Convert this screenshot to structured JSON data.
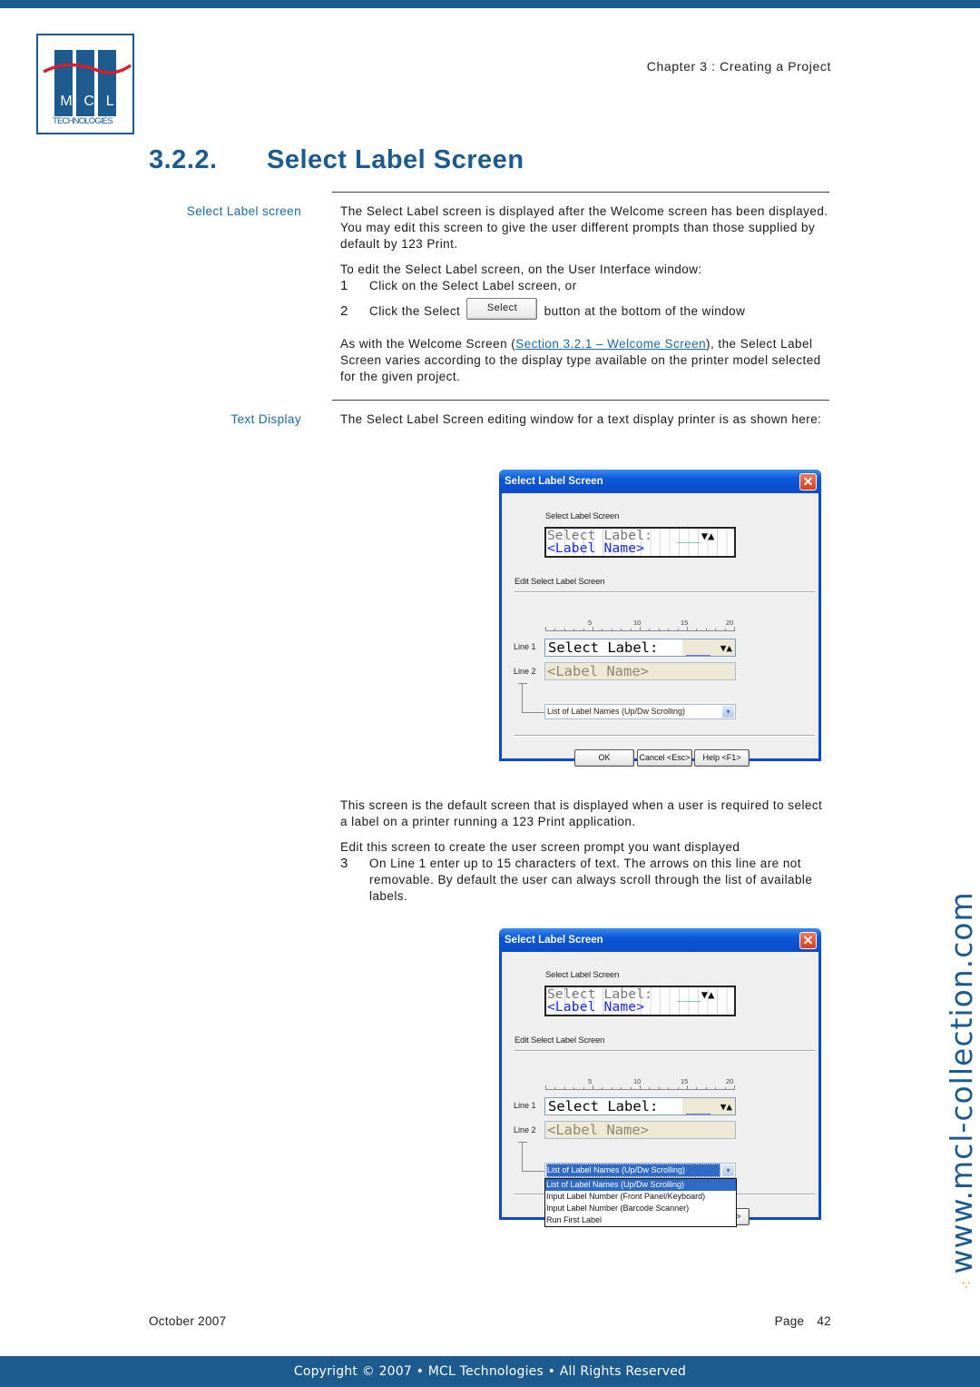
{
  "header": {
    "chapter": "Chapter 3 : Creating a Project",
    "logo": {
      "letters": [
        "M",
        "C",
        "L"
      ],
      "subtitle": "TECHNOLOGIES"
    }
  },
  "section": {
    "number": "3.2.2.",
    "title": "Select Label Screen"
  },
  "block1": {
    "side_label": "Select Label screen",
    "para1": "The Select Label screen is displayed after the Welcome screen has been displayed. You may edit this screen to give the user different prompts than those supplied by default by 123 Print.",
    "intro": "To edit the Select Label screen, on the User Interface window:",
    "steps": [
      {
        "n": "1",
        "text": "Click on the Select Label screen, or"
      },
      {
        "n": "2",
        "text_before": "Click the Select",
        "button": "Select",
        "text_after": "button at the bottom of the window"
      }
    ],
    "para2_before": "As with the Welcome Screen (",
    "para2_link": "Section 3.2.1 – Welcome Screen",
    "para2_after": "), the Select Label Screen varies according to the display type available on the printer model selected for the given project."
  },
  "block2": {
    "side_label": "Text Display",
    "para1": "The Select Label Screen editing window for a text display printer is as shown here:",
    "para2": "This screen is the default screen that is displayed when a user is required to select a label on a printer running a 123 Print application.",
    "para3": "Edit this screen to create the user screen prompt you want displayed",
    "step3": {
      "n": "3",
      "text": "On Line 1 enter up to 15 characters of text. The arrows on this line are not removable. By default the user can always scroll through the list of available labels."
    }
  },
  "dialog": {
    "title": "Select Label  Screen",
    "close": "✕",
    "preview_label": "Select Label  Screen",
    "lcd_line1": "Select Label:",
    "lcd_dashes": "___",
    "lcd_arrows": "▼▲",
    "lcd_line2": "<Label Name>",
    "edit_label": "Edit Select Label  Screen",
    "ruler_ticks": [
      "5",
      "10",
      "15",
      "20"
    ],
    "line1_label": "Line 1",
    "line1_value": "Select Label:",
    "line1_tail": "___",
    "line1_arrows": "▼▲",
    "line2_label": "Line 2",
    "line2_value": "<Label Name>",
    "combo_value": "List of Label Names (Up/Dw Scrolling)",
    "combo_arrow": "▾",
    "buttons": {
      "ok": "OK",
      "cancel": "Cancel <Esc>",
      "help": "Help <F1>"
    },
    "dropdown_options": [
      "List of Label Names (Up/Dw Scrolling)",
      "Input Label Number (Front Panel/Keyboard)",
      "Input Label Number (Barcode Scanner)",
      "Run First Label"
    ],
    "dropdown_selected_index": 0
  },
  "footer": {
    "date": "October 2007",
    "page_label": "Page",
    "page_number": "42",
    "copyright": "Copyright © 2007 • MCL Technologies • All Rights Reserved",
    "watermark": "www.mcl-collection.com",
    "watermark_dots": "⁖"
  },
  "colors": {
    "brand_blue": "#1d5a8e",
    "link_blue": "#1d6aa3",
    "xp_title_blue": "#0b57d8",
    "accent_orange": "#f39c12",
    "logo_red": "#d0202e"
  }
}
